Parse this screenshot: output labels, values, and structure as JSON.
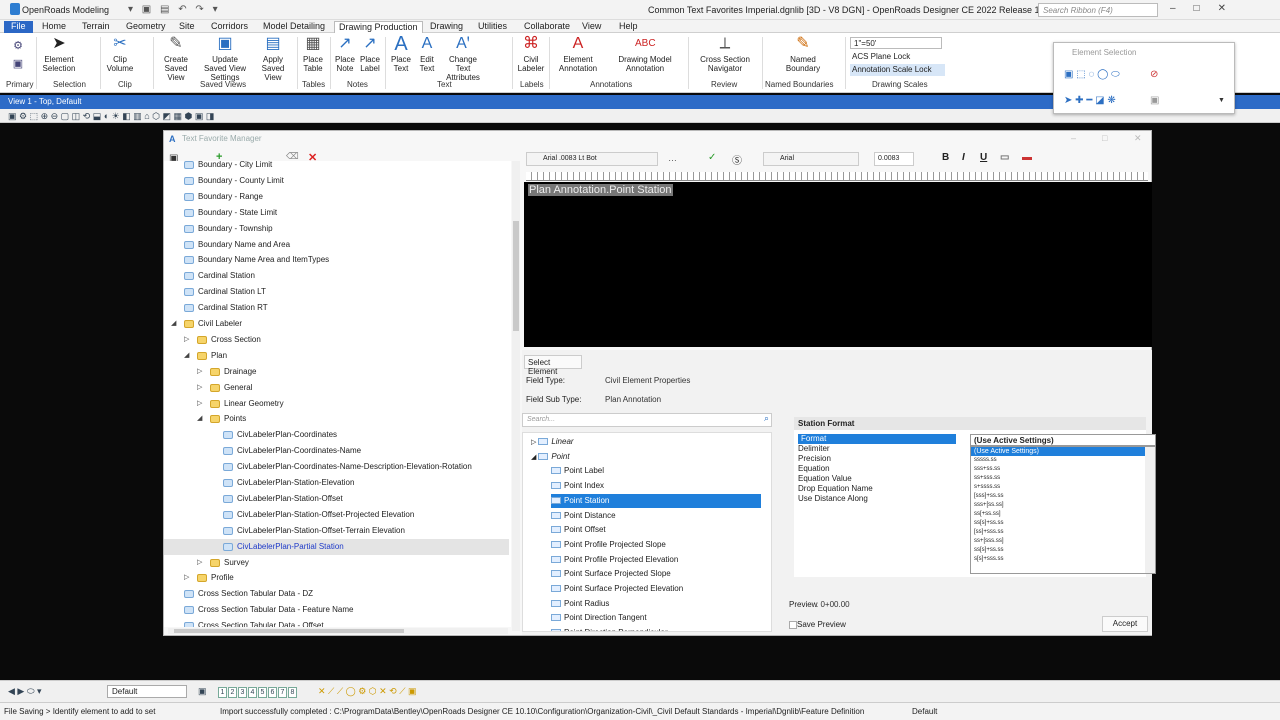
{
  "titlebar": {
    "workspace": "OpenRoads Modeling",
    "document": "Common Text Favorites Imperial.dgnlib [3D - V8 DGN] - OpenRoads Designer CE 2022 Release 1",
    "search_placeholder": "Search Ribbon (F4)"
  },
  "menu": [
    "File",
    "Home",
    "Terrain",
    "Geometry",
    "Site",
    "Corridors",
    "Model Detailing",
    "Drawing Production",
    "Drawing",
    "Utilities",
    "Collaborate",
    "View",
    "Help"
  ],
  "ribbon": {
    "buttons": [
      {
        "label": "Element Selection",
        "icon": "arrow-cursor-icon"
      },
      {
        "label": "Clip Volume",
        "icon": "scissors-icon"
      },
      {
        "label": "Create Saved View",
        "icon": "create-view-icon"
      },
      {
        "label": "Update Saved View Settings",
        "icon": "update-view-icon"
      },
      {
        "label": "Apply Saved View",
        "icon": "apply-view-icon"
      },
      {
        "label": "Place Table",
        "icon": "table-icon"
      },
      {
        "label": "Place Note",
        "icon": "note-icon"
      },
      {
        "label": "Place Label",
        "icon": "label-icon"
      },
      {
        "label": "Place Text",
        "icon": "text-a-icon"
      },
      {
        "label": "Edit Text",
        "icon": "edit-text-icon"
      },
      {
        "label": "Change Text Attributes",
        "icon": "text-attributes-icon"
      },
      {
        "label": "Civil Labeler",
        "icon": "civil-labeler-icon"
      },
      {
        "label": "Element Annotation",
        "icon": "element-annotation-icon"
      },
      {
        "label": "Drawing Model Annotation",
        "icon": "abc-annotation-icon"
      },
      {
        "label": "Cross Section Navigator",
        "icon": "cross-section-icon"
      },
      {
        "label": "Named Boundary",
        "icon": "pencil-icon"
      }
    ],
    "groups": [
      "Primary",
      "Selection",
      "Clip",
      "Saved Views",
      "Tables",
      "Notes",
      "Text",
      "Labels",
      "Annotations",
      "Review",
      "Named Boundaries",
      "Drawing Scales"
    ],
    "scale": "1\"=50'",
    "acs_lock": "ACS Plane Lock",
    "annotation_lock": "Annotation Scale Lock"
  },
  "element_selection_title": "Element Selection",
  "view_title": "View 1 - Top, Default",
  "dialog": {
    "title": "Text Favorite Manager",
    "tree": [
      {
        "label": "Boundary - City Limit",
        "depth": 0,
        "type": "std"
      },
      {
        "label": "Boundary - County Limit",
        "depth": 0,
        "type": "std"
      },
      {
        "label": "Boundary - Range",
        "depth": 0,
        "type": "std"
      },
      {
        "label": "Boundary - State Limit",
        "depth": 0,
        "type": "std"
      },
      {
        "label": "Boundary - Township",
        "depth": 0,
        "type": "std"
      },
      {
        "label": "Boundary Name and Area",
        "depth": 0,
        "type": "std"
      },
      {
        "label": "Boundary Name Area and ItemTypes",
        "depth": 0,
        "type": "std"
      },
      {
        "label": "Cardinal Station",
        "depth": 0,
        "type": "std"
      },
      {
        "label": "Cardinal Station LT",
        "depth": 0,
        "type": "std"
      },
      {
        "label": "Cardinal Station RT",
        "depth": 0,
        "type": "std"
      },
      {
        "label": "Civil Labeler",
        "depth": 0,
        "type": "fold",
        "exp": "◢"
      },
      {
        "label": "Cross Section",
        "depth": 1,
        "type": "fold",
        "exp": "▷"
      },
      {
        "label": "Plan",
        "depth": 1,
        "type": "fold",
        "exp": "◢"
      },
      {
        "label": "Drainage",
        "depth": 2,
        "type": "fold",
        "exp": "▷"
      },
      {
        "label": "General",
        "depth": 2,
        "type": "fold",
        "exp": "▷"
      },
      {
        "label": "Linear Geometry",
        "depth": 2,
        "type": "fold",
        "exp": "▷"
      },
      {
        "label": "Points",
        "depth": 2,
        "type": "fold",
        "exp": "◢"
      },
      {
        "label": "CivLabelerPlan-Coordinates",
        "depth": 3,
        "type": "std"
      },
      {
        "label": "CivLabelerPlan-Coordinates-Name",
        "depth": 3,
        "type": "std"
      },
      {
        "label": "CivLabelerPlan-Coordinates-Name-Description-Elevation-Rotation",
        "depth": 3,
        "type": "std"
      },
      {
        "label": "CivLabelerPlan-Station-Elevation",
        "depth": 3,
        "type": "std"
      },
      {
        "label": "CivLabelerPlan-Station-Offset",
        "depth": 3,
        "type": "std"
      },
      {
        "label": "CivLabelerPlan-Station-Offset-Projected Elevation",
        "depth": 3,
        "type": "std"
      },
      {
        "label": "CivLabelerPlan-Station-Offset-Terrain Elevation",
        "depth": 3,
        "type": "std"
      },
      {
        "label": "CivLabelerPlan-Partial Station",
        "depth": 3,
        "type": "std",
        "selected": true
      },
      {
        "label": "Survey",
        "depth": 2,
        "type": "fold",
        "exp": "▷"
      },
      {
        "label": "Profile",
        "depth": 1,
        "type": "fold",
        "exp": "▷"
      },
      {
        "label": "Cross Section Tabular Data - DZ",
        "depth": 0,
        "type": "std"
      },
      {
        "label": "Cross Section Tabular Data - Feature Name",
        "depth": 0,
        "type": "std"
      },
      {
        "label": "Cross Section Tabular Data - Offset",
        "depth": 0,
        "type": "std"
      }
    ],
    "font": "Arial .0083 Lt Bot",
    "font2": "Arial",
    "text_height": "0.0083",
    "editor_text": "Plan Annotation.Point Station",
    "select_element": "Select Element",
    "field_type_label": "Field Type:",
    "field_type_value": "Civil Element Properties",
    "field_subtype_label": "Field Sub Type:",
    "field_subtype_value": "Plan Annotation",
    "search_placeholder": "Search...",
    "left_tree": [
      {
        "label": "Linear",
        "depth": 0,
        "folder": true,
        "exp": "▷"
      },
      {
        "label": "Point",
        "depth": 0,
        "folder": true,
        "exp": "◢"
      },
      {
        "label": "Point Label",
        "depth": 1
      },
      {
        "label": "Point Index",
        "depth": 1
      },
      {
        "label": "Point Station",
        "depth": 1,
        "selected": true
      },
      {
        "label": "Point Distance",
        "depth": 1
      },
      {
        "label": "Point Offset",
        "depth": 1
      },
      {
        "label": "Point Profile Projected Slope",
        "depth": 1
      },
      {
        "label": "Point Profile Projected Elevation",
        "depth": 1
      },
      {
        "label": "Point Surface Projected Slope",
        "depth": 1
      },
      {
        "label": "Point Surface Projected Elevation",
        "depth": 1
      },
      {
        "label": "Point Radius",
        "depth": 1
      },
      {
        "label": "Point Direction Tangent",
        "depth": 1
      },
      {
        "label": "Point Direction Perpendicular",
        "depth": 1
      }
    ],
    "station_format": {
      "header": "Station Format",
      "rows": [
        "Format",
        "Delimiter",
        "Precision",
        "Equation",
        "Equation Value",
        "Drop Equation Name",
        "Use Distance Along"
      ],
      "value": "(Use Active Settings)",
      "options": [
        "(Use Active Settings)",
        "sssss.ss",
        "sss+ss.ss",
        "ss+sss.ss",
        "s+ssss.ss",
        "[sss]+ss.ss",
        "sss+[ss.ss]",
        "ss[+ss.ss]",
        "ss[s]+ss.ss",
        "[ss]+sss.ss",
        "ss+[sss.ss]",
        "ss[s]+ss.ss",
        "s[s]+sss.ss"
      ]
    },
    "preview_label": "Preview",
    "preview_value": ": 0+00.00",
    "save_preview": "Save Preview",
    "accept": "Accept"
  },
  "bottom": {
    "model": "Default",
    "view_numbers": [
      "1",
      "2",
      "3",
      "4",
      "5",
      "6",
      "7",
      "8"
    ]
  },
  "status": {
    "left": "File Saving > Identify element to add to set",
    "message": "Import successfully completed : C:\\ProgramData\\Bentley\\OpenRoads Designer CE 10.10\\Configuration\\Organization-Civil\\_Civil Default Standards - Imperial\\Dgnlib\\Feature Definition",
    "level": "Default"
  }
}
